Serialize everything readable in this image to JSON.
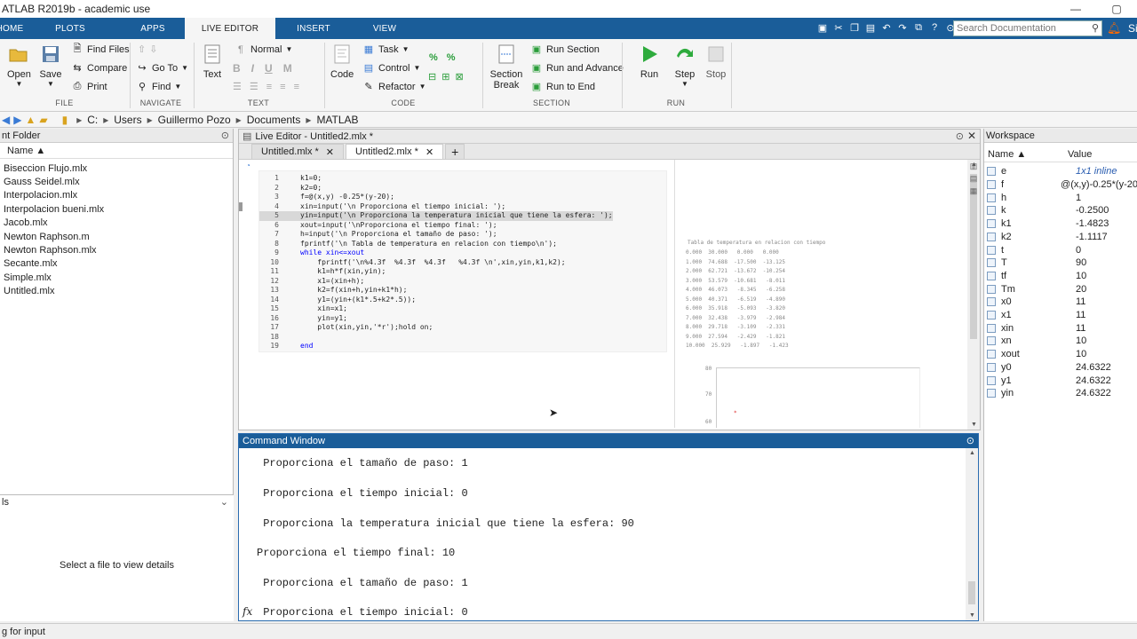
{
  "window": {
    "title": "ATLAB R2019b - academic use",
    "min": "—",
    "max": "▢"
  },
  "tabs": [
    "HOME",
    "PLOTS",
    "APPS",
    "LIVE EDITOR",
    "INSERT",
    "VIEW"
  ],
  "search": {
    "placeholder": "Search Documentation"
  },
  "user_initial": "Si",
  "ribbon": {
    "open": "Open",
    "save": "Save",
    "find_files": "Find Files",
    "compare": "Compare",
    "print": "Print",
    "goto": "Go To",
    "find": "Find",
    "text": "Text",
    "normal": "Normal",
    "code": "Code",
    "task": "Task",
    "control": "Control",
    "refactor": "Refactor",
    "section_break": "Section Break",
    "run_section": "Run Section",
    "run_advance": "Run and Advance",
    "run_end": "Run to End",
    "run": "Run",
    "step": "Step",
    "stop": "Stop",
    "groups": {
      "file": "FILE",
      "navigate": "NAVIGATE",
      "text": "TEXT",
      "code": "CODE",
      "section": "SECTION",
      "run": "RUN"
    }
  },
  "path": [
    "C:",
    "Users",
    "Guillermo Pozo",
    "Documents",
    "MATLAB"
  ],
  "current_folder": {
    "title": "nt Folder",
    "col": "Name ▲",
    "files": [
      "Biseccion Flujo.mlx",
      "Gauss Seidel.mlx",
      "Interpolacion.mlx",
      "Interpolacion bueni.mlx",
      "Jacob.mlx",
      "Newton Raphson.m",
      "Newton Raphson.mlx",
      "Secante.mlx",
      "Simple.mlx",
      "Untitled.mlx"
    ]
  },
  "details": {
    "title": "ls",
    "msg": "Select a file to view details"
  },
  "editor": {
    "title": "Live Editor - Untitled2.mlx *",
    "tabs": [
      "Untitled.mlx *",
      "Untitled2.mlx *"
    ],
    "plus": "+"
  },
  "code": [
    [
      "1",
      "k1=0;"
    ],
    [
      "2",
      "k2=0;"
    ],
    [
      "3",
      "f=@(x,y) -0.25*(y-20);"
    ],
    [
      "4",
      "xin=input('\\n Proporciona el tiempo inicial: ');"
    ],
    [
      "5",
      "yin=input('\\n Proporciona la temperatura inicial que tiene la esfera: ');"
    ],
    [
      "6",
      "xout=input('\\nProporciona el tiempo final: ');"
    ],
    [
      "7",
      "h=input('\\n Proporciona el tamaño de paso: ');"
    ],
    [
      "8",
      "fprintf('\\n Tabla de temperatura en relacion con tiempo\\n');"
    ],
    [
      "9",
      "while xin<=xout"
    ],
    [
      "10",
      "    fprintf('\\n%4.3f  %4.3f  %4.3f   %4.3f \\n',xin,yin,k1,k2);"
    ],
    [
      "11",
      "    k1=h*f(xin,yin);"
    ],
    [
      "12",
      "    x1=(xin+h);"
    ],
    [
      "13",
      "    k2=f(xin+h,yin+k1*h);"
    ],
    [
      "14",
      "    y1=(yin+(k1*.5+k2*.5));"
    ],
    [
      "15",
      "    xin=x1;"
    ],
    [
      "16",
      "    yin=y1;"
    ],
    [
      "17",
      "    plot(xin,yin,'*r');hold on;"
    ],
    [
      "18",
      ""
    ],
    [
      "19",
      "end"
    ]
  ],
  "output": {
    "title": "Tabla de temperatura en relacion con tiempo",
    "rows": [
      "0.000  30.000   0.000   0.000",
      "1.000  74.688  -17.500  -13.125",
      "2.000  62.721  -13.672  -10.254",
      "3.000  53.579  -10.681   -8.011",
      "4.000  46.073   -8.345   -6.258",
      "5.000  40.371   -6.519   -4.890",
      "6.000  35.918   -5.093   -3.820",
      "7.000  32.438   -3.979   -2.984",
      "8.000  29.718   -3.109   -2.331",
      "9.000  27.594   -2.429   -1.821",
      "10.000  25.929   -1.897   -1.423"
    ],
    "plot_ticks": [
      "80",
      "70",
      "60"
    ]
  },
  "command_window": {
    "title": "Command Window",
    "prompt": "fx",
    "lines": [
      " Proporciona el tamaño de paso: 1",
      " Proporciona el tiempo inicial: 0",
      " Proporciona la temperatura inicial que tiene la esfera: 90",
      "Proporciona el tiempo final: 10",
      " Proporciona el tamaño de paso: 1",
      " Proporciona el tiempo inicial: 0"
    ]
  },
  "workspace": {
    "title": "Workspace",
    "col_name": "Name ▲",
    "col_value": "Value",
    "vars": [
      [
        "e",
        "1x1 inline"
      ],
      [
        "f",
        "@(x,y)-0.25*(y-20"
      ],
      [
        "h",
        "1"
      ],
      [
        "k",
        "-0.2500"
      ],
      [
        "k1",
        "-1.4823"
      ],
      [
        "k2",
        "-1.1117"
      ],
      [
        "t",
        "0"
      ],
      [
        "T",
        "90"
      ],
      [
        "tf",
        "10"
      ],
      [
        "Tm",
        "20"
      ],
      [
        "x0",
        "11"
      ],
      [
        "x1",
        "11"
      ],
      [
        "xin",
        "11"
      ],
      [
        "xn",
        "10"
      ],
      [
        "xout",
        "10"
      ],
      [
        "y0",
        "24.6322"
      ],
      [
        "y1",
        "24.6322"
      ],
      [
        "yin",
        "24.6322"
      ]
    ]
  },
  "status": "g for input"
}
